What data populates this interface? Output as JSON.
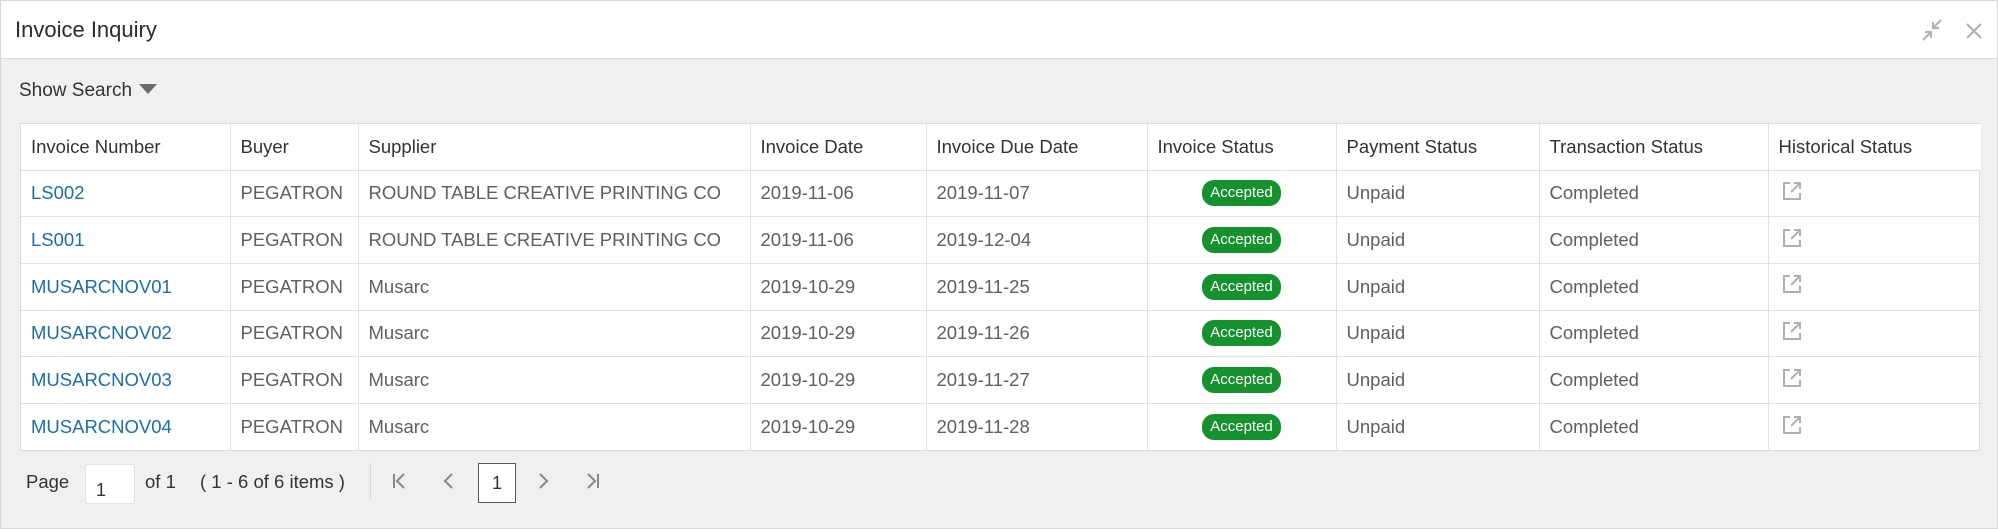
{
  "window": {
    "title": "Invoice Inquiry"
  },
  "search": {
    "toggle_label": "Show Search"
  },
  "table": {
    "headers": [
      "Invoice Number",
      "Buyer",
      "Supplier",
      "Invoice Date",
      "Invoice Due Date",
      "Invoice Status",
      "Payment Status",
      "Transaction Status",
      "Historical Status"
    ],
    "rows": [
      {
        "invoice": "LS002",
        "buyer": "PEGATRON",
        "supplier": "ROUND TABLE CREATIVE PRINTING CO",
        "date": "2019-11-06",
        "due": "2019-11-07",
        "status": "Accepted",
        "payment": "Unpaid",
        "transaction": "Completed"
      },
      {
        "invoice": "LS001",
        "buyer": "PEGATRON",
        "supplier": "ROUND TABLE CREATIVE PRINTING CO",
        "date": "2019-11-06",
        "due": "2019-12-04",
        "status": "Accepted",
        "payment": "Unpaid",
        "transaction": "Completed"
      },
      {
        "invoice": "MUSARCNOV01",
        "buyer": "PEGATRON",
        "supplier": "Musarc",
        "date": "2019-10-29",
        "due": "2019-11-25",
        "status": "Accepted",
        "payment": "Unpaid",
        "transaction": "Completed"
      },
      {
        "invoice": "MUSARCNOV02",
        "buyer": "PEGATRON",
        "supplier": "Musarc",
        "date": "2019-10-29",
        "due": "2019-11-26",
        "status": "Accepted",
        "payment": "Unpaid",
        "transaction": "Completed"
      },
      {
        "invoice": "MUSARCNOV03",
        "buyer": "PEGATRON",
        "supplier": "Musarc",
        "date": "2019-10-29",
        "due": "2019-11-27",
        "status": "Accepted",
        "payment": "Unpaid",
        "transaction": "Completed"
      },
      {
        "invoice": "MUSARCNOV04",
        "buyer": "PEGATRON",
        "supplier": "Musarc",
        "date": "2019-10-29",
        "due": "2019-11-28",
        "status": "Accepted",
        "payment": "Unpaid",
        "transaction": "Completed"
      }
    ]
  },
  "pager": {
    "page_label": "Page",
    "page_value": "1",
    "of_label": "of 1",
    "range_label": "( 1 - 6 of 6 items )",
    "current_page": "1"
  },
  "colors": {
    "link": "#1b6fa8",
    "accepted_badge": "#15912e"
  },
  "icons": {
    "collapse": "collapse-arrows-icon",
    "close": "close-icon",
    "search_toggle": "caret-down-icon",
    "history": "external-link-icon",
    "first": "first-page-icon",
    "prev": "prev-page-icon",
    "next": "next-page-icon",
    "last": "last-page-icon"
  }
}
